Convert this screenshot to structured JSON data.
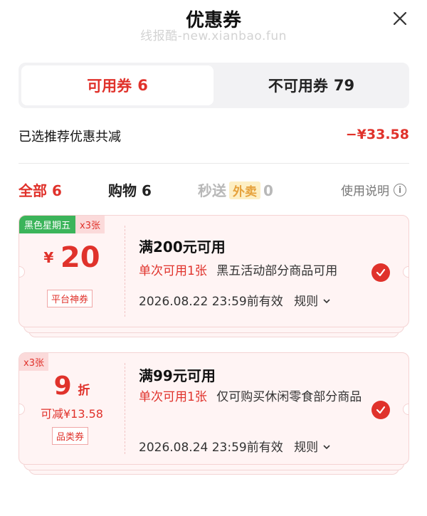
{
  "header": {
    "title": "优惠券",
    "watermark": "线报酷-new.xianbao.fun"
  },
  "tabs": {
    "available": {
      "label": "可用券",
      "count": "6"
    },
    "unavailable": {
      "label": "不可用券",
      "count": "79"
    }
  },
  "summary": {
    "label": "已选推荐优惠共减",
    "amount": "−¥33.58"
  },
  "filters": {
    "all": {
      "label": "全部",
      "count": "6"
    },
    "shopping": {
      "label": "购物",
      "count": "6"
    },
    "flash": {
      "label": "秒送",
      "tag": "外卖",
      "count": "0"
    },
    "help": "使用说明"
  },
  "coupons": [
    {
      "tag": "黑色星期五",
      "quantity": "x3张",
      "currency": "¥",
      "amount": "20",
      "badge": "平台神券",
      "condition": "满200元可用",
      "limit": "单次可用1张",
      "scope": "黑五活动部分商品可用",
      "expiry": "2026.08.22 23:59前有效",
      "rule": "规则"
    },
    {
      "quantity": "x3张",
      "discount": "9",
      "discount_unit": "折",
      "saving": "可减¥13.58",
      "badge": "品类券",
      "condition": "满99元可用",
      "limit": "单次可用1张",
      "scope": "仅可购买休闲零食部分商品",
      "expiry": "2026.08.24 23:59前有效",
      "rule": "规则"
    }
  ],
  "colors": {
    "accent": "#e0322b",
    "tag_green": "#3bb45a",
    "coupon_bg": "#fff4f4"
  }
}
